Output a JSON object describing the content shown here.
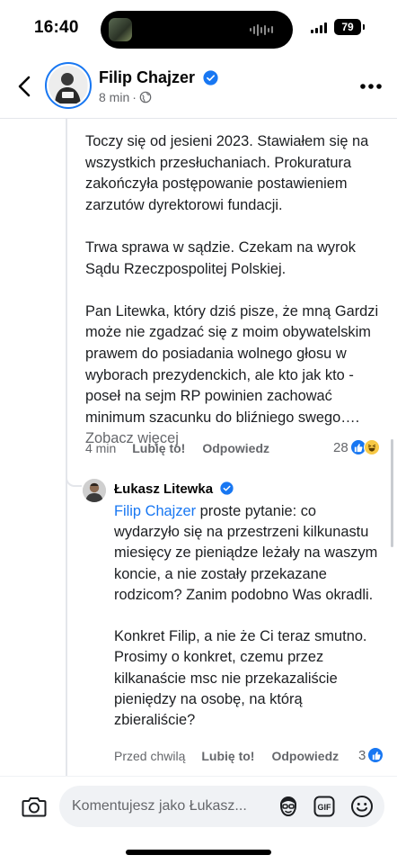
{
  "status_bar": {
    "time": "16:40",
    "battery": "79"
  },
  "header": {
    "author_name": "Filip Chajzer",
    "post_age": "8 min",
    "meta_separator": "·"
  },
  "post": {
    "paragraphs": [
      "Toczy się od jesieni 2023. Stawiałem się na wszystkich przesłuchaniach. Prokuratura zakończyła postępowanie postawieniem zarzutów dyrektorowi fundacji.",
      "Trwa sprawa w sądzie. Czekam na wyrok Sądu Rzeczpospolitej Polskiej.",
      "Pan Litewka, który dziś pisze, że mną Gardzi może nie zgadzać się z moim obywatelskim prawem do posiadania wolnego głosu w wyborach prezydenckich, ale kto jak kto - poseł na sejm RP powinien zachować minimum szacunku do bliźniego swego…."
    ],
    "see_more": "Zobacz więcej",
    "time": "4 min",
    "like_label": "Lubię to!",
    "reply_label": "Odpowiedz",
    "reaction_count": "28"
  },
  "reply": {
    "author_name": "Łukasz Litewka",
    "mention": "Filip Chajzer",
    "first_paragraph_rest": " proste pytanie: co wydarzyło się na przestrzeni kilkunastu miesięcy ze pieniądze leżały na waszym koncie, a nie zostały przekazane rodzicom? Zanim podobno Was okradli.",
    "second_paragraph": "Konkret Filip, a nie że Ci teraz smutno. Prosimy o konkret, czemu przez kilkanaście msc nie przekazaliście pieniędzy na osobę, na którą zbieraliście?",
    "time": "Przed chwilą",
    "like_label": "Lubię to!",
    "reply_label": "Odpowiedz",
    "reaction_count": "3"
  },
  "composer": {
    "placeholder": "Komentujesz jako Łukasz..."
  },
  "colors": {
    "accent": "#1877f2",
    "secondary_text": "#65676b",
    "composer_bg": "#f0f2f5"
  }
}
